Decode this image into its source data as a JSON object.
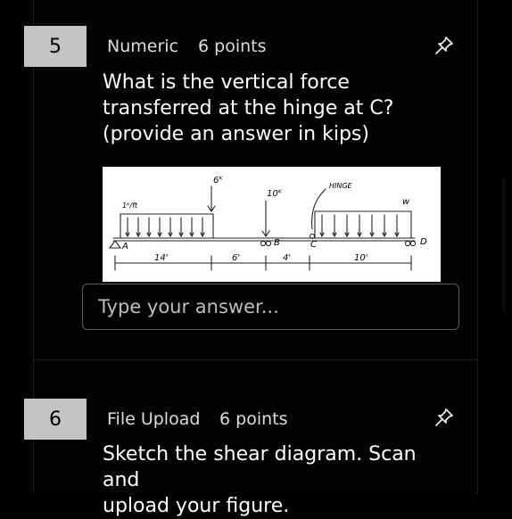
{
  "questions": [
    {
      "number": "5",
      "type": "Numeric",
      "points": "6 points",
      "text_lines": [
        "What is the vertical force",
        "transferred at the hinge at C?",
        "(provide an answer in kips)"
      ],
      "answer_placeholder": "Type your answer...",
      "figure": {
        "load_point_A": "6ᴷ",
        "load_point_B": "10ᴷ",
        "hinge_label": "HINGE",
        "distributed_left": "1ᴷ/ft",
        "distributed_right": "w",
        "support_A": "A",
        "support_B": "B",
        "support_C": "C",
        "support_D": "D",
        "dim_1": "14'",
        "dim_2": "6'",
        "dim_3": "4'",
        "dim_4": "10'"
      }
    },
    {
      "number": "6",
      "type": "File Upload",
      "points": "6 points",
      "text_lines": [
        "Sketch the shear diagram. Scan and",
        "upload your figure."
      ]
    }
  ],
  "colors": {
    "background": "#000000",
    "number_box": "#c4c4c4",
    "meta_text": "#dcdcdc"
  },
  "icons": [
    "pin-icon"
  ]
}
